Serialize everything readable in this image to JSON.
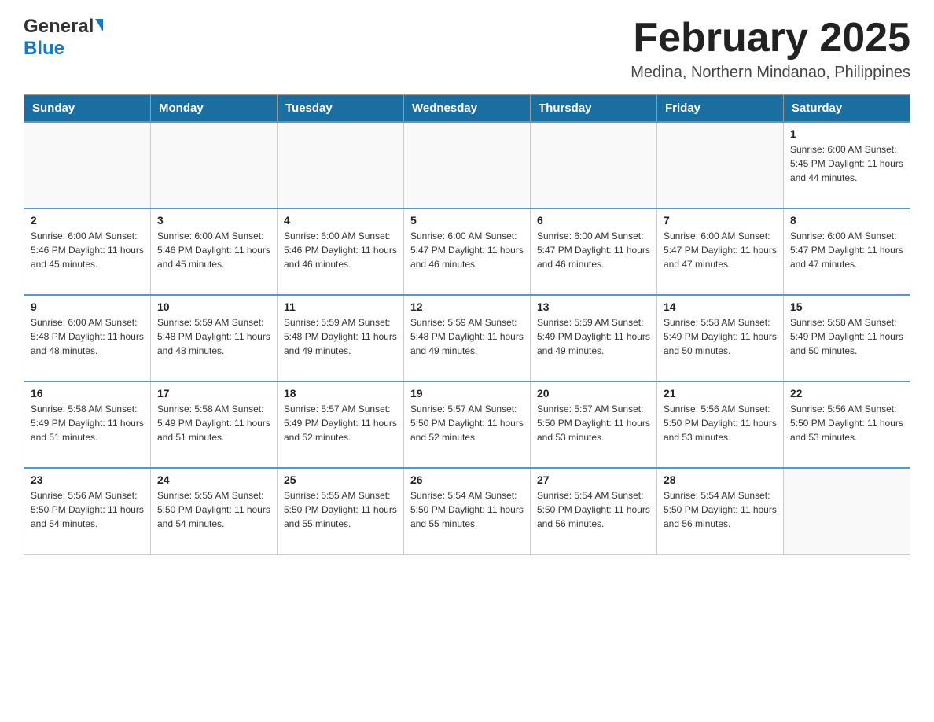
{
  "header": {
    "logo": {
      "general": "General",
      "blue": "Blue",
      "tagline": ""
    },
    "title": "February 2025",
    "location": "Medina, Northern Mindanao, Philippines"
  },
  "calendar": {
    "days_of_week": [
      "Sunday",
      "Monday",
      "Tuesday",
      "Wednesday",
      "Thursday",
      "Friday",
      "Saturday"
    ],
    "weeks": [
      {
        "days": [
          {
            "date": "",
            "info": ""
          },
          {
            "date": "",
            "info": ""
          },
          {
            "date": "",
            "info": ""
          },
          {
            "date": "",
            "info": ""
          },
          {
            "date": "",
            "info": ""
          },
          {
            "date": "",
            "info": ""
          },
          {
            "date": "1",
            "info": "Sunrise: 6:00 AM\nSunset: 5:45 PM\nDaylight: 11 hours and 44 minutes."
          }
        ]
      },
      {
        "days": [
          {
            "date": "2",
            "info": "Sunrise: 6:00 AM\nSunset: 5:46 PM\nDaylight: 11 hours and 45 minutes."
          },
          {
            "date": "3",
            "info": "Sunrise: 6:00 AM\nSunset: 5:46 PM\nDaylight: 11 hours and 45 minutes."
          },
          {
            "date": "4",
            "info": "Sunrise: 6:00 AM\nSunset: 5:46 PM\nDaylight: 11 hours and 46 minutes."
          },
          {
            "date": "5",
            "info": "Sunrise: 6:00 AM\nSunset: 5:47 PM\nDaylight: 11 hours and 46 minutes."
          },
          {
            "date": "6",
            "info": "Sunrise: 6:00 AM\nSunset: 5:47 PM\nDaylight: 11 hours and 46 minutes."
          },
          {
            "date": "7",
            "info": "Sunrise: 6:00 AM\nSunset: 5:47 PM\nDaylight: 11 hours and 47 minutes."
          },
          {
            "date": "8",
            "info": "Sunrise: 6:00 AM\nSunset: 5:47 PM\nDaylight: 11 hours and 47 minutes."
          }
        ]
      },
      {
        "days": [
          {
            "date": "9",
            "info": "Sunrise: 6:00 AM\nSunset: 5:48 PM\nDaylight: 11 hours and 48 minutes."
          },
          {
            "date": "10",
            "info": "Sunrise: 5:59 AM\nSunset: 5:48 PM\nDaylight: 11 hours and 48 minutes."
          },
          {
            "date": "11",
            "info": "Sunrise: 5:59 AM\nSunset: 5:48 PM\nDaylight: 11 hours and 49 minutes."
          },
          {
            "date": "12",
            "info": "Sunrise: 5:59 AM\nSunset: 5:48 PM\nDaylight: 11 hours and 49 minutes."
          },
          {
            "date": "13",
            "info": "Sunrise: 5:59 AM\nSunset: 5:49 PM\nDaylight: 11 hours and 49 minutes."
          },
          {
            "date": "14",
            "info": "Sunrise: 5:58 AM\nSunset: 5:49 PM\nDaylight: 11 hours and 50 minutes."
          },
          {
            "date": "15",
            "info": "Sunrise: 5:58 AM\nSunset: 5:49 PM\nDaylight: 11 hours and 50 minutes."
          }
        ]
      },
      {
        "days": [
          {
            "date": "16",
            "info": "Sunrise: 5:58 AM\nSunset: 5:49 PM\nDaylight: 11 hours and 51 minutes."
          },
          {
            "date": "17",
            "info": "Sunrise: 5:58 AM\nSunset: 5:49 PM\nDaylight: 11 hours and 51 minutes."
          },
          {
            "date": "18",
            "info": "Sunrise: 5:57 AM\nSunset: 5:49 PM\nDaylight: 11 hours and 52 minutes."
          },
          {
            "date": "19",
            "info": "Sunrise: 5:57 AM\nSunset: 5:50 PM\nDaylight: 11 hours and 52 minutes."
          },
          {
            "date": "20",
            "info": "Sunrise: 5:57 AM\nSunset: 5:50 PM\nDaylight: 11 hours and 53 minutes."
          },
          {
            "date": "21",
            "info": "Sunrise: 5:56 AM\nSunset: 5:50 PM\nDaylight: 11 hours and 53 minutes."
          },
          {
            "date": "22",
            "info": "Sunrise: 5:56 AM\nSunset: 5:50 PM\nDaylight: 11 hours and 53 minutes."
          }
        ]
      },
      {
        "days": [
          {
            "date": "23",
            "info": "Sunrise: 5:56 AM\nSunset: 5:50 PM\nDaylight: 11 hours and 54 minutes."
          },
          {
            "date": "24",
            "info": "Sunrise: 5:55 AM\nSunset: 5:50 PM\nDaylight: 11 hours and 54 minutes."
          },
          {
            "date": "25",
            "info": "Sunrise: 5:55 AM\nSunset: 5:50 PM\nDaylight: 11 hours and 55 minutes."
          },
          {
            "date": "26",
            "info": "Sunrise: 5:54 AM\nSunset: 5:50 PM\nDaylight: 11 hours and 55 minutes."
          },
          {
            "date": "27",
            "info": "Sunrise: 5:54 AM\nSunset: 5:50 PM\nDaylight: 11 hours and 56 minutes."
          },
          {
            "date": "28",
            "info": "Sunrise: 5:54 AM\nSunset: 5:50 PM\nDaylight: 11 hours and 56 minutes."
          },
          {
            "date": "",
            "info": ""
          }
        ]
      }
    ]
  }
}
